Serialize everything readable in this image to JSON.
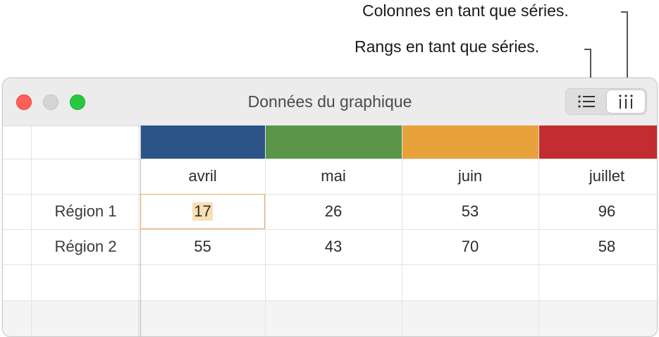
{
  "callouts": {
    "columns_as_series": "Colonnes en tant que séries.",
    "rows_as_series": "Rangs en tant que séries."
  },
  "window": {
    "title": "Données du graphique"
  },
  "toolbar": {
    "rows_icon": "list-icon",
    "columns_icon": "columns-icon",
    "selected": "columns"
  },
  "table": {
    "series_colors": [
      "#2c5489",
      "#5b9549",
      "#e8a23b",
      "#c32d31"
    ],
    "columns": [
      "avril",
      "mai",
      "juin",
      "juillet"
    ],
    "rows": [
      {
        "label": "Région 1",
        "values": [
          "17",
          "26",
          "53",
          "96"
        ]
      },
      {
        "label": "Région 2",
        "values": [
          "55",
          "43",
          "70",
          "58"
        ]
      }
    ],
    "selected_cell": "Région 1 / avril"
  }
}
